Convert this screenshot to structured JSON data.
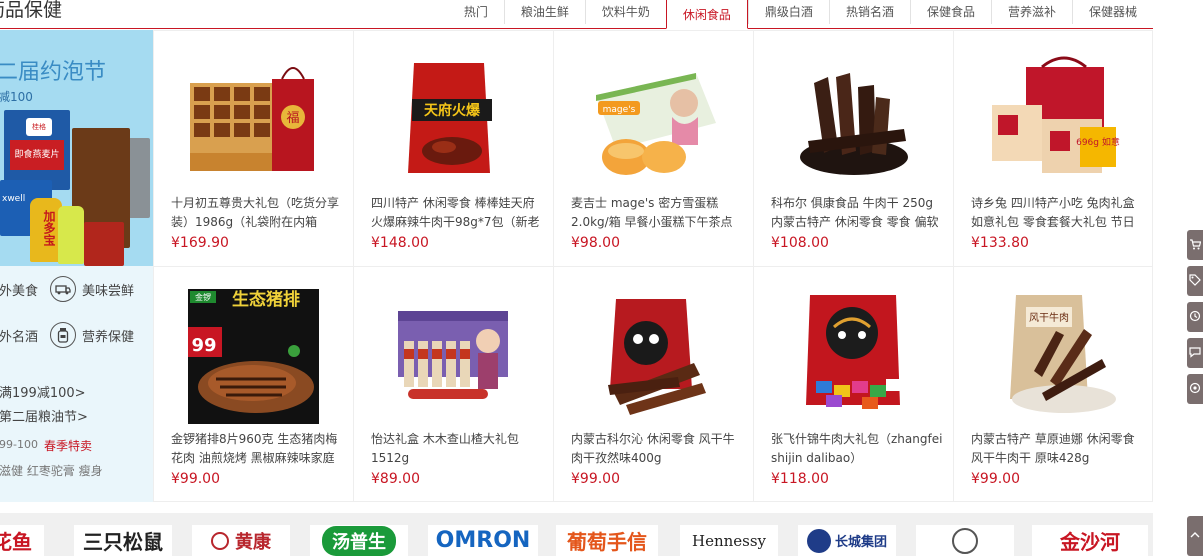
{
  "header": {
    "title": "药品保健",
    "tabs": [
      {
        "label": "热门",
        "active": false
      },
      {
        "label": "粮油生鲜",
        "active": false
      },
      {
        "label": "饮料牛奶",
        "active": false
      },
      {
        "label": "休闲食品",
        "active": true
      },
      {
        "label": "鼎级白酒",
        "active": false
      },
      {
        "label": "热销名酒",
        "active": false
      },
      {
        "label": "保健食品",
        "active": false
      },
      {
        "label": "营养滋补",
        "active": false
      },
      {
        "label": "保健器械",
        "active": false
      }
    ]
  },
  "left": {
    "banner_title": "二届约泡节",
    "banner_sub": "减100",
    "banner_pkg_quaker": "桂格",
    "banner_pkg_quaker_sub": "即食燕麦片",
    "banner_pkg_maxwell": "xwell",
    "banner_pkg_jiaduobao": "加多宝",
    "cat_links": [
      {
        "label": "外美食",
        "icon": ""
      },
      {
        "label": "美味尝鲜",
        "icon": "car-icon"
      },
      {
        "label": "外名酒",
        "icon": ""
      },
      {
        "label": "营养保健",
        "icon": "bottle-icon"
      }
    ],
    "promo_1": "满199减100>",
    "promo_2": "第二届粮油节>",
    "promo_3_prefix": "99-100",
    "promo_3_highlight": "春季特卖",
    "promo_4": "滋健  红枣驼膏  瘦身"
  },
  "products": [
    {
      "name": "十月初五尊贵大礼包（吃货分享装）1986g（礼袋附在内箱",
      "price": "¥169.90",
      "image": "gift-box"
    },
    {
      "name": "四川特产 休闲零食 棒棒娃天府火爆麻辣牛肉干98g*7包（新老",
      "price": "¥148.00",
      "image": "beef-jerky-bag"
    },
    {
      "name": "麦吉士 mage's 密方雪蛋糕 2.0kg/箱 早餐小蛋糕下午茶点",
      "price": "¥98.00",
      "image": "cake-box"
    },
    {
      "name": "科布尔 俱康食品 牛肉干 250g 内蒙古特产 休闲零食 零食 偏软",
      "price": "¥108.00",
      "image": "dried-beef"
    },
    {
      "name": "诗乡兔 四川特产小吃 兔肉礼盒 如意礼包 零食套餐大礼包 节日",
      "price": "¥133.80",
      "image": "rabbit-gift"
    },
    {
      "name": "金锣猪排8片960克 生态猪肉梅花肉 油煎烧烤 黑椒麻辣味家庭",
      "price": "¥99.00",
      "image": "pork-chop"
    },
    {
      "name": "怡达礼盒 木木查山楂大礼包 1512g",
      "price": "¥89.00",
      "image": "hawthorn-box"
    },
    {
      "name": "内蒙古科尔沁 休闲零食 风干牛肉干孜然味400g",
      "price": "¥99.00",
      "image": "beef-strip-bag"
    },
    {
      "name": "张飞什锦牛肉大礼包（zhangfei shijin dalibao）",
      "price": "¥118.00",
      "image": "zhangfei-bag"
    },
    {
      "name": "内蒙古特产 草原迪娜 休闲零食 风干牛肉干 原味428g",
      "price": "¥99.00",
      "image": "air-dried-beef"
    }
  ],
  "product_image_text": {
    "gift_box_char": "福",
    "beef_bag_title": "天府火爆",
    "cake_box_brand": "mage's",
    "rabbit_gift_tag": "696g 如意",
    "pork_brand": "金锣",
    "pork_title": "生态猪排",
    "pork_price_tag": "99",
    "air_dried_label": "风干牛肉"
  },
  "brands": [
    {
      "label": "花鱼",
      "color": "#c81623"
    },
    {
      "label": "三只松鼠",
      "color": "#222222"
    },
    {
      "label": "黄康",
      "color": "#b8262d"
    },
    {
      "label": "汤普生",
      "color": "#1a9a3a"
    },
    {
      "label": "OMRON",
      "color": "#1565c0"
    },
    {
      "label": "葡萄手信",
      "color": "#e4561b"
    },
    {
      "label": "Hennessy",
      "color": "#222222"
    },
    {
      "label": "长城集团",
      "color": "#1f3c88"
    },
    {
      "label": "",
      "color": "#333333"
    },
    {
      "label": "金沙河",
      "color": "#c81623"
    }
  ],
  "sidebar_tools": [
    {
      "icon": "cart-icon"
    },
    {
      "icon": "tag-icon"
    },
    {
      "icon": "history-icon"
    },
    {
      "icon": "message-icon"
    },
    {
      "icon": "service-icon"
    },
    {
      "icon": "back-to-top-icon"
    }
  ]
}
